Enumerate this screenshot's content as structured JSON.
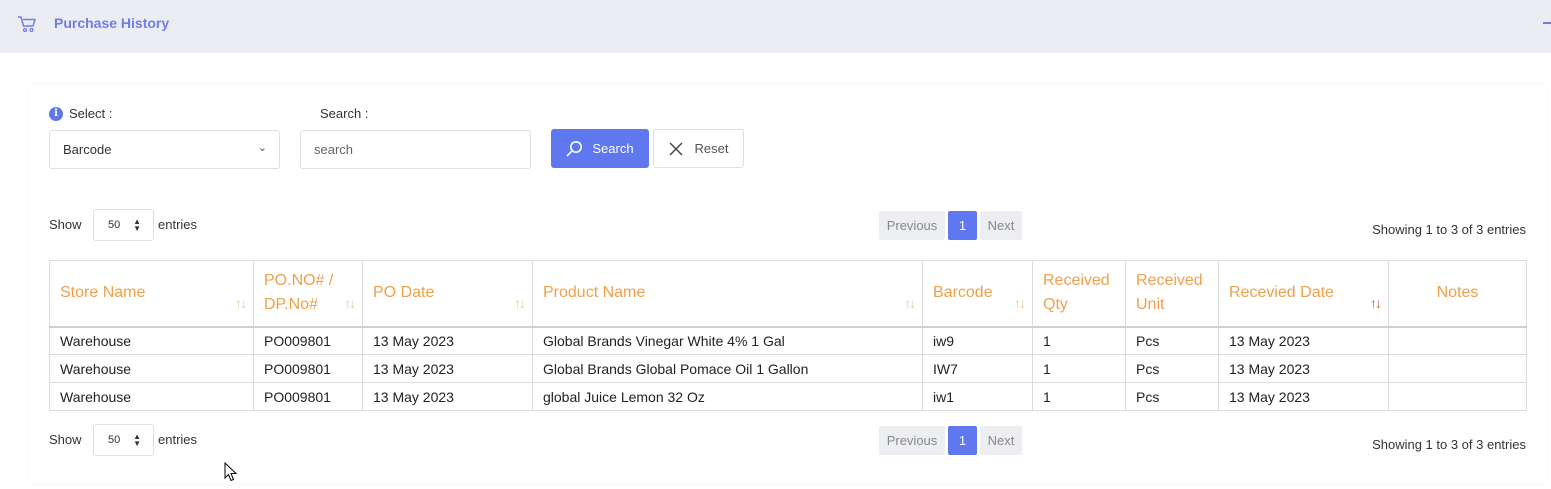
{
  "header": {
    "title": "Purchase History",
    "cart_icon": "cart-icon",
    "collapse_icon": "minus-icon"
  },
  "filters": {
    "select_label": "Select :",
    "select_value": "Barcode",
    "search_label": "Search :",
    "search_placeholder": "search",
    "search_button": "Search",
    "reset_button": "Reset"
  },
  "table_controls": {
    "show_label": "Show",
    "entries_value": "50",
    "entries_label": "entries",
    "prev": "Previous",
    "page": "1",
    "next": "Next",
    "showing": "Showing 1 to 3 of 3 entries"
  },
  "table": {
    "columns": [
      "Store Name",
      "PO.NO# / DP.No#",
      "PO Date",
      "Product Name",
      "Barcode",
      "Received Qty",
      "Received Unit",
      "Recevied Date",
      "Notes"
    ],
    "rows": [
      [
        "Warehouse",
        "PO009801",
        "13 May 2023",
        "Global Brands Vinegar White 4% 1 Gal",
        "iw9",
        "1",
        "Pcs",
        "13 May 2023",
        ""
      ],
      [
        "Warehouse",
        "PO009801",
        "13 May 2023",
        "Global Brands Global Pomace Oil 1 Gallon",
        "IW7",
        "1",
        "Pcs",
        "13 May 2023",
        ""
      ],
      [
        "Warehouse",
        "PO009801",
        "13 May 2023",
        "global Juice Lemon 32 Oz",
        "iw1",
        "1",
        "Pcs",
        "13 May 2023",
        ""
      ]
    ]
  },
  "colors": {
    "accent": "#5f78f0",
    "header_text": "#f0a04a",
    "sort_active": "#e65b4b"
  }
}
